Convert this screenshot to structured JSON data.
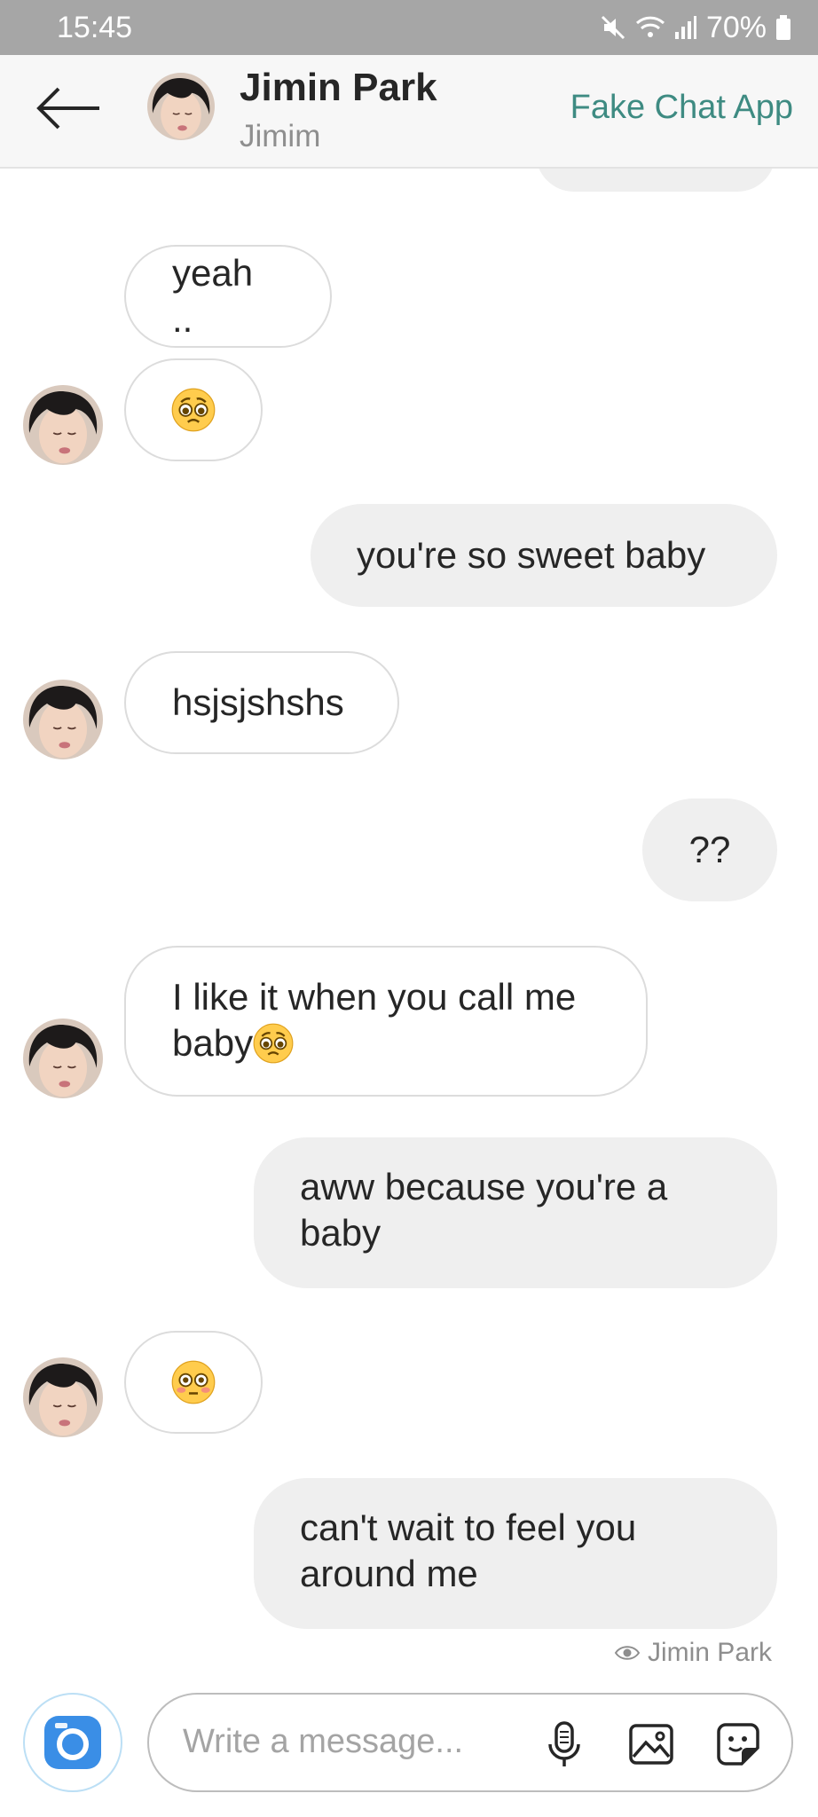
{
  "status_bar": {
    "time": "15:45",
    "battery": "70%"
  },
  "header": {
    "name": "Jimin Park",
    "subtitle": "Jimim",
    "app_label": "Fake Chat App"
  },
  "messages": [
    {
      "side": "in",
      "text": "yeah .."
    },
    {
      "side": "in",
      "emoji": "pleading-face-icon"
    },
    {
      "side": "out",
      "text": "you're so sweet baby"
    },
    {
      "side": "in",
      "text": "hsjsjshshs"
    },
    {
      "side": "out",
      "text": "??"
    },
    {
      "side": "in",
      "line1": "I like it when you call me",
      "line2": "baby",
      "emoji": "pleading-face-icon"
    },
    {
      "side": "out",
      "line1": "aww because you're a",
      "line2": "baby"
    },
    {
      "side": "in",
      "emoji": "flushed-face-icon"
    },
    {
      "side": "out",
      "line1": "can't wait to feel you",
      "line2": "around me"
    }
  ],
  "seen": {
    "label": "Jimin Park"
  },
  "composer": {
    "placeholder": "Write a message..."
  },
  "colors": {
    "accent": "#3e8b82",
    "camera": "#3a8ee6",
    "incoming_bg": "#ffffff",
    "outgoing_bg": "#efefef"
  }
}
